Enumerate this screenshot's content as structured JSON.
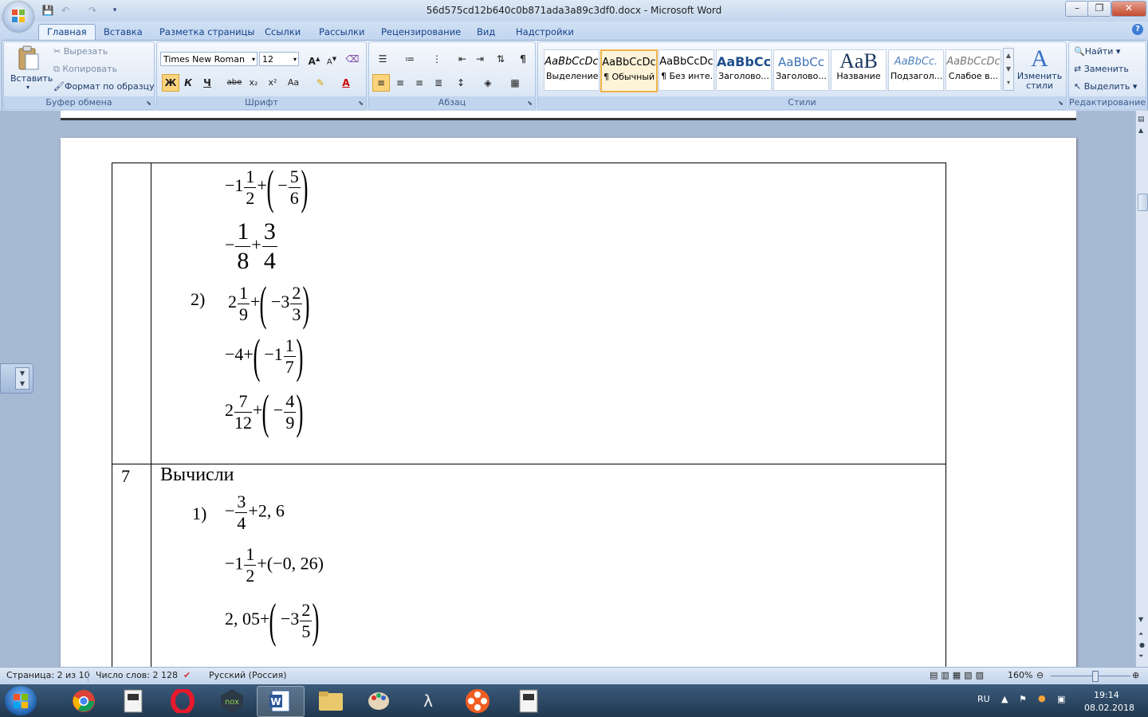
{
  "window": {
    "title": "56d575cd12b640c0b871ada3a89c3df0.docx - Microsoft Word"
  },
  "tabs": [
    "Главная",
    "Вставка",
    "Разметка страницы",
    "Ссылки",
    "Рассылки",
    "Рецензирование",
    "Вид",
    "Надстройки"
  ],
  "ribbon": {
    "clipboard": {
      "label": "Буфер обмена",
      "paste": "Вставить",
      "cut": "Вырезать",
      "copy": "Копировать",
      "format_painter": "Формат по образцу"
    },
    "font": {
      "label": "Шрифт",
      "family": "Times New Roman",
      "size": "12",
      "bold": "Ж",
      "italic": "К",
      "underline": "Ч",
      "strike": "abe",
      "subscript": "x₂",
      "superscript": "x²",
      "case": "Aa",
      "grow": "A",
      "shrink": "A"
    },
    "paragraph": {
      "label": "Абзац",
      "pilcrow": "¶"
    },
    "styles": {
      "label": "Стили",
      "items": [
        {
          "preview": "AaBbCcDc",
          "name": "Выделение"
        },
        {
          "preview": "AaBbCcDc",
          "name": "¶ Обычный"
        },
        {
          "preview": "AaBbCcDc",
          "name": "¶ Без инте..."
        },
        {
          "preview": "AaBbCc",
          "name": "Заголово..."
        },
        {
          "preview": "AaBbCc",
          "name": "Заголово..."
        },
        {
          "preview": "AaB",
          "name": "Название"
        },
        {
          "preview": "AaBbCc.",
          "name": "Подзагол..."
        },
        {
          "preview": "AaBbCcDc",
          "name": "Слабое в..."
        }
      ],
      "change_styles": "Изменить стили"
    },
    "editing": {
      "label": "Редактирование",
      "find": "Найти",
      "replace": "Заменить",
      "select": "Выделить"
    }
  },
  "document": {
    "row6": {
      "lines": [
        {
          "pre": "−1",
          "frac": [
            "1",
            "2"
          ],
          "mid": "+",
          "paren": true,
          "inner_pre": "−",
          "inner_frac": [
            "5",
            "6"
          ],
          "post": ""
        },
        {
          "pre": "−",
          "frac": [
            "1",
            "8"
          ],
          "mid": "+",
          "frac2": [
            "3",
            "4"
          ]
        },
        {
          "label": "2)",
          "pre": "2",
          "frac": [
            "1",
            "9"
          ],
          "mid": "+",
          "paren": true,
          "inner_pre": "−3",
          "inner_frac": [
            "2",
            "3"
          ]
        },
        {
          "pre": "−4",
          "mid": "+",
          "paren": true,
          "inner_pre": "−1",
          "inner_frac": [
            "1",
            "7"
          ]
        },
        {
          "pre": "2",
          "frac": [
            "7",
            "12"
          ],
          "mid": "+",
          "paren": true,
          "inner_pre": "−",
          "inner_frac": [
            "4",
            "9"
          ]
        }
      ]
    },
    "row7": {
      "number": "7",
      "heading": "Вычисли",
      "lines": [
        {
          "label": "1)",
          "pre": "−",
          "frac": [
            "3",
            "4"
          ],
          "mid": "+",
          "post": "2, 6"
        },
        {
          "pre": "−1",
          "frac": [
            "1",
            "2"
          ],
          "mid": "+",
          "post": "(−0, 26)"
        },
        {
          "pre": "2, 05",
          "mid": "+",
          "paren": true,
          "inner_pre": "−3",
          "inner_frac": [
            "2",
            "5"
          ]
        }
      ]
    }
  },
  "status": {
    "page": "Страница: 2 из 10",
    "words": "Число слов: 2 128",
    "language": "Русский (Россия)",
    "zoom": "160%"
  },
  "taskbar": {
    "lang": "RU",
    "time": "19:14",
    "date": "08.02.2018"
  }
}
